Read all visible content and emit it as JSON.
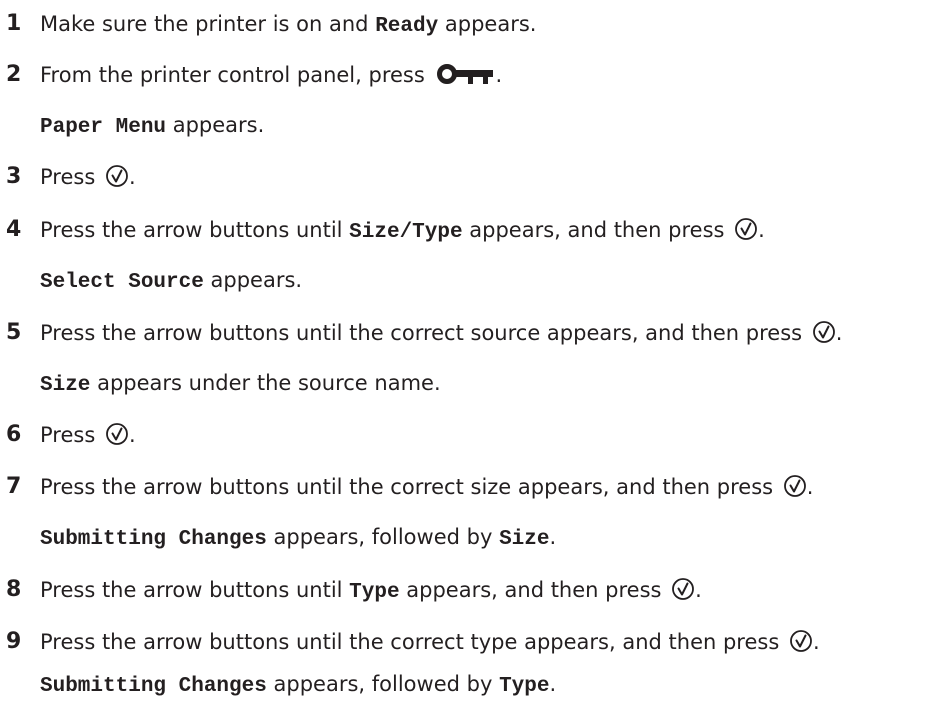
{
  "steps": [
    {
      "number": "1",
      "pre": "Make sure the printer is on and ",
      "code": "Ready",
      "post": " appears."
    },
    {
      "number": "2",
      "pre": "From the printer control panel, press ",
      "icon": "menu-key-icon",
      "post": "."
    },
    {
      "sub": true,
      "code": "Paper Menu",
      "post": " appears."
    },
    {
      "number": "3",
      "pre": "Press ",
      "icon": "select-check-icon",
      "post": "."
    },
    {
      "number": "4",
      "pre": "Press the arrow buttons until ",
      "code": "Size/Type",
      "mid": " appears, and then press ",
      "icon": "select-check-icon",
      "post": "."
    },
    {
      "sub": true,
      "code": "Select Source",
      "post": " appears."
    },
    {
      "number": "5",
      "pre": "Press the arrow buttons until the correct source appears, and then press ",
      "icon": "select-check-icon",
      "post": "."
    },
    {
      "sub": true,
      "code": "Size",
      "post": " appears under the source name."
    },
    {
      "number": "6",
      "pre": "Press ",
      "icon": "select-check-icon",
      "post": "."
    },
    {
      "number": "7",
      "pre": "Press the arrow buttons until the correct size appears, and then press ",
      "icon": "select-check-icon",
      "post": "."
    },
    {
      "sub": true,
      "code": "Submitting Changes",
      "post": " appears, followed by ",
      "code2": "Size",
      "post2": "."
    },
    {
      "number": "8",
      "pre": "Press the arrow buttons until ",
      "code": "Type",
      "mid": " appears, and then press ",
      "icon": "select-check-icon",
      "post": "."
    },
    {
      "number": "9",
      "pre": "Press the arrow buttons until the correct type appears, and then press ",
      "icon": "select-check-icon",
      "post": "."
    },
    {
      "sub": true,
      "code": "Submitting Changes",
      "post": " appears, followed by ",
      "code2": "Type",
      "post2": "."
    }
  ]
}
